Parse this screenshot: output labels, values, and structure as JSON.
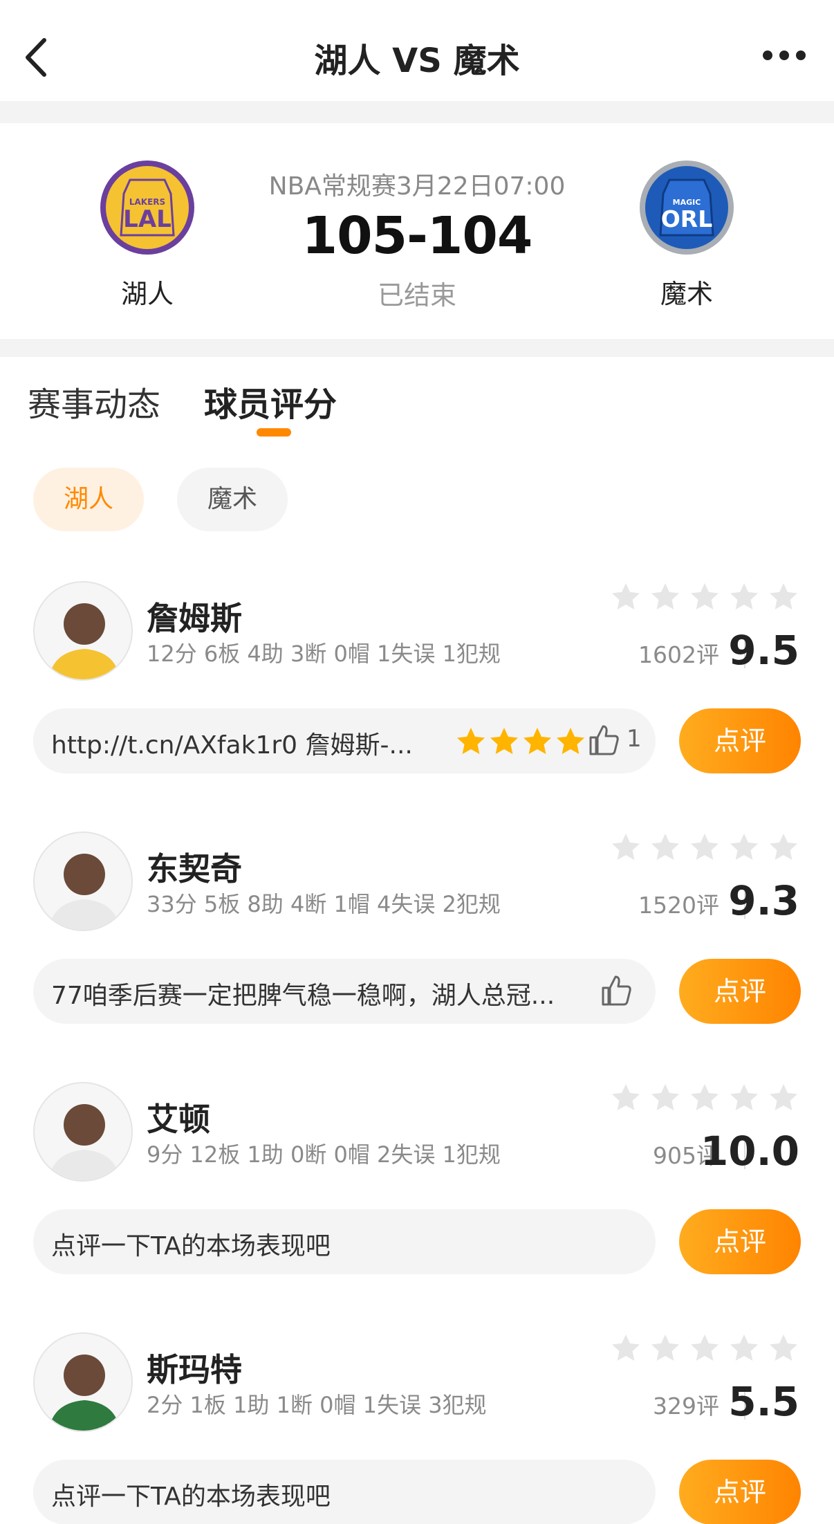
{
  "header": {
    "title": "湖人 VS 魔术",
    "back_icon": "chevron-left-icon",
    "more_icon": "more-dots-icon"
  },
  "match": {
    "home": {
      "name": "湖人",
      "logo_text_top": "LAKERS",
      "logo_text": "LAL",
      "color": "#F5C232",
      "accent": "#6B3F9E"
    },
    "away": {
      "name": "魔术",
      "logo_text_top": "MAGIC",
      "logo_text": "ORL",
      "color": "#1E5BB8",
      "accent": "#A9ADB4"
    },
    "league": "NBA常规赛3月22日07:00",
    "score": "105-104",
    "status": "已结束"
  },
  "tabs": [
    {
      "label": "赛事动态",
      "active": false
    },
    {
      "label": "球员评分",
      "active": true
    }
  ],
  "filters": [
    {
      "label": "湖人",
      "active": true
    },
    {
      "label": "魔术",
      "active": false
    }
  ],
  "players": [
    {
      "name": "詹姆斯",
      "stats": "12分 6板 4助 3断 0帽 1失误 1犯规",
      "rating_count": "1602评",
      "score": "9.5",
      "comment": "http://t.cn/AXfak1r0 詹姆斯-...",
      "comment_stars": 4,
      "likes": "1",
      "button": "点评"
    },
    {
      "name": "东契奇",
      "stats": "33分 5板 8助 4断 1帽 4失误 2犯规",
      "rating_count": "1520评",
      "score": "9.3",
      "comment": "77咱季后赛一定把脾气稳一稳啊，湖人总冠...",
      "comment_stars": 0,
      "likes": "",
      "button": "点评"
    },
    {
      "name": "艾顿",
      "stats": "9分 12板 1助 0断 0帽 2失误 1犯规",
      "rating_count": "905评",
      "score": "10.0",
      "comment": "点评一下TA的本场表现吧",
      "comment_stars": 0,
      "likes": "",
      "button": "点评"
    },
    {
      "name": "斯玛特",
      "stats": "2分 1板 1助 1断 0帽 1失误 3犯规",
      "rating_count": "329评",
      "score": "5.5",
      "comment": "点评一下TA的本场表现吧",
      "comment_stars": 0,
      "likes": "",
      "button": "点评"
    }
  ],
  "colors": {
    "accent": "#FF8A00",
    "star_empty": "#E6E6E6",
    "star_filled": "#FFB400"
  }
}
